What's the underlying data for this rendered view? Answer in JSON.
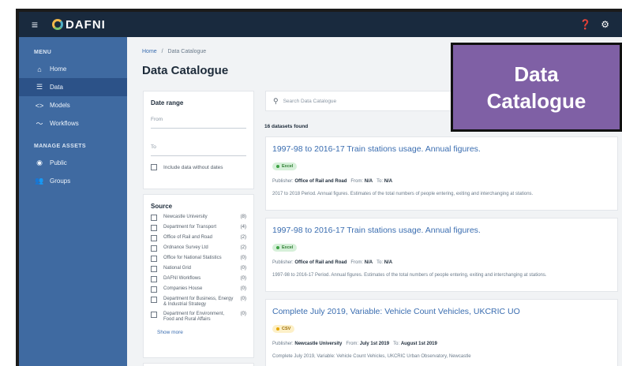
{
  "app": {
    "logo_text": "DAFNI"
  },
  "topbar": {
    "menu_icon": "menu-icon",
    "help_icon": "help-icon",
    "settings_icon": "gear-icon"
  },
  "sidebar": {
    "menu_heading": "MENU",
    "items": [
      {
        "label": "Home",
        "icon": "home-icon",
        "glyph": "🏠"
      },
      {
        "label": "Data",
        "icon": "list-icon",
        "glyph": "☰"
      },
      {
        "label": "Models",
        "icon": "code-icon",
        "glyph": "<>"
      },
      {
        "label": "Workflows",
        "icon": "workflow-icon",
        "glyph": "〜"
      }
    ],
    "assets_heading": "MANAGE ASSETS",
    "asset_items": [
      {
        "label": "Public",
        "icon": "eye-icon",
        "glyph": "👁"
      },
      {
        "label": "Groups",
        "icon": "group-icon",
        "glyph": "👥"
      }
    ]
  },
  "breadcrumb": {
    "home": "Home",
    "separator": "/",
    "current": "Data Catalogue"
  },
  "page_title": "Data Catalogue",
  "date_filter": {
    "heading": "Date range",
    "from_label": "From",
    "to_label": "To",
    "include_label": "Include data without dates"
  },
  "source_filter": {
    "heading": "Source",
    "items": [
      {
        "name": "Newcastle University",
        "count": "(8)"
      },
      {
        "name": "Department for Transport",
        "count": "(4)"
      },
      {
        "name": "Office of Rail and Road",
        "count": "(2)"
      },
      {
        "name": "Ordnance Survey Ltd",
        "count": "(2)"
      },
      {
        "name": "Office for National Statistics",
        "count": "(0)"
      },
      {
        "name": "National Grid",
        "count": "(0)"
      },
      {
        "name": "DAFNI Workflows",
        "count": "(0)"
      },
      {
        "name": "Companies House",
        "count": "(0)"
      },
      {
        "name": "Department for Business, Energy & Industrial Strategy",
        "count": "(0)"
      },
      {
        "name": "Department for Environment, Food and Rural Affairs",
        "count": "(0)"
      }
    ],
    "show_more": "Show more"
  },
  "search": {
    "placeholder": "Search Data Catalogue"
  },
  "results_count": "16 datasets found",
  "results": [
    {
      "title": "1997-98 to 2016-17 Train stations usage. Annual figures.",
      "format": "Excel",
      "publisher_label": "Publisher:",
      "publisher": "Office of Rail and Road",
      "from_label": "From:",
      "from": "N/A",
      "to_label": "To:",
      "to": "N/A",
      "description": "2017 to 2018 Period. Annual figures. Estimates of the total numbers of people entering, exiting and interchanging at stations."
    },
    {
      "title": "1997-98 to 2016-17 Train stations usage. Annual figures.",
      "format": "Excel",
      "publisher_label": "Publisher:",
      "publisher": "Office of Rail and Road",
      "from_label": "From:",
      "from": "N/A",
      "to_label": "To:",
      "to": "N/A",
      "description": "1997-98 to 2016-17 Period. Annual figures. Estimates of the total numbers of people entering, exiting and interchanging at stations."
    },
    {
      "title": "Complete July 2019, Variable: Vehicle Count Vehicles, UKCRIC UO",
      "format": "CSV",
      "publisher_label": "Publisher:",
      "publisher": "Newcastle University",
      "from_label": "From:",
      "from": "July 1st 2019",
      "to_label": "To:",
      "to": "August 1st 2019",
      "description": "Complete July 2019, Variable: Vehicle Count Vehicles, UKCRIC Urban Observatory, Newcastle"
    }
  ],
  "overlay": {
    "line1": "Data",
    "line2": "Catalogue"
  },
  "colors": {
    "sidebar": "#3f6aa1",
    "topbar": "#192a3e",
    "link": "#3a6db0",
    "overlay": "#7f60a5"
  }
}
